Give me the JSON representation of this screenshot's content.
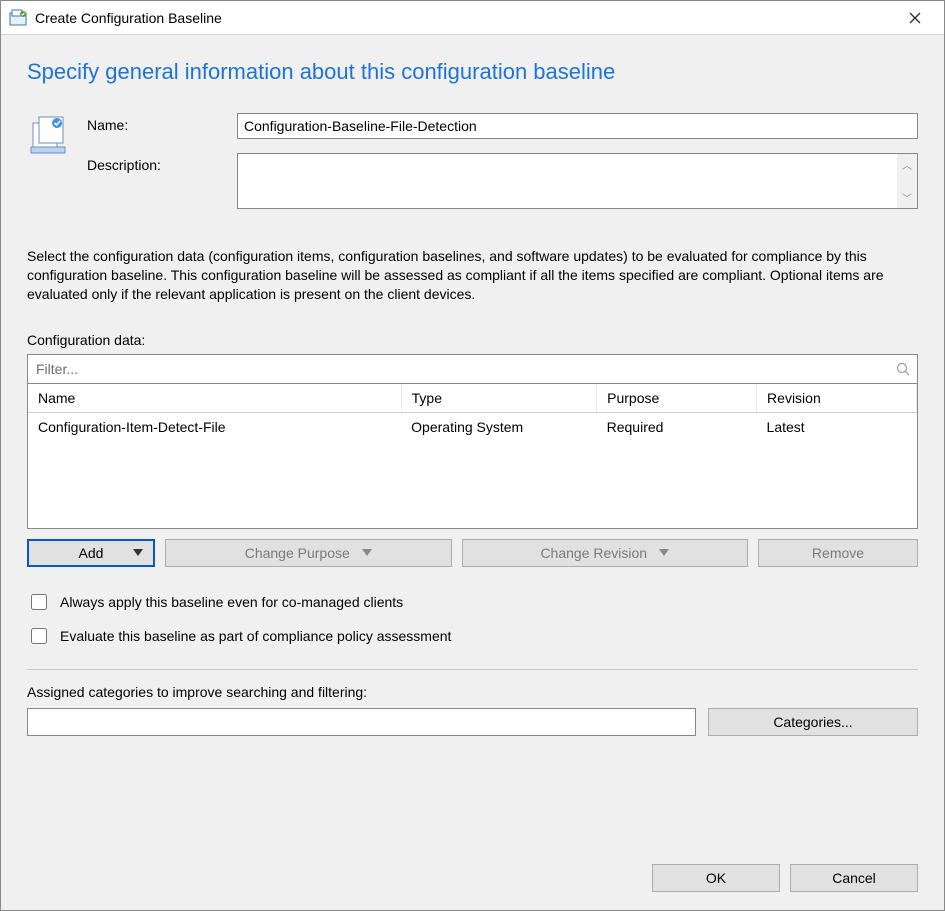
{
  "window": {
    "title": "Create Configuration Baseline"
  },
  "heading": "Specify general information about this configuration baseline",
  "form": {
    "name_label": "Name:",
    "name_value": "Configuration-Baseline-File-Detection",
    "description_label": "Description:",
    "description_value": ""
  },
  "instruction": "Select the configuration data (configuration items, configuration baselines, and software updates) to be evaluated for compliance by this configuration baseline. This configuration baseline will be assessed as compliant if all the items specified are compliant. Optional items are evaluated only if the relevant application is present on  the client devices.",
  "configdata": {
    "label": "Configuration data:",
    "filter_placeholder": "Filter...",
    "columns": {
      "name": "Name",
      "type": "Type",
      "purpose": "Purpose",
      "revision": "Revision"
    },
    "rows": [
      {
        "name": "Configuration-Item-Detect-File",
        "type": "Operating System",
        "purpose": "Required",
        "revision": "Latest"
      }
    ]
  },
  "buttons": {
    "add": "Add",
    "change_purpose": "Change Purpose",
    "change_revision": "Change Revision",
    "remove": "Remove"
  },
  "checkboxes": {
    "always_apply": "Always apply this baseline even for co-managed clients",
    "evaluate_policy": "Evaluate this baseline as part of compliance policy assessment"
  },
  "categories": {
    "label": "Assigned categories to improve searching and filtering:",
    "value": "",
    "button": "Categories..."
  },
  "footer": {
    "ok": "OK",
    "cancel": "Cancel"
  }
}
